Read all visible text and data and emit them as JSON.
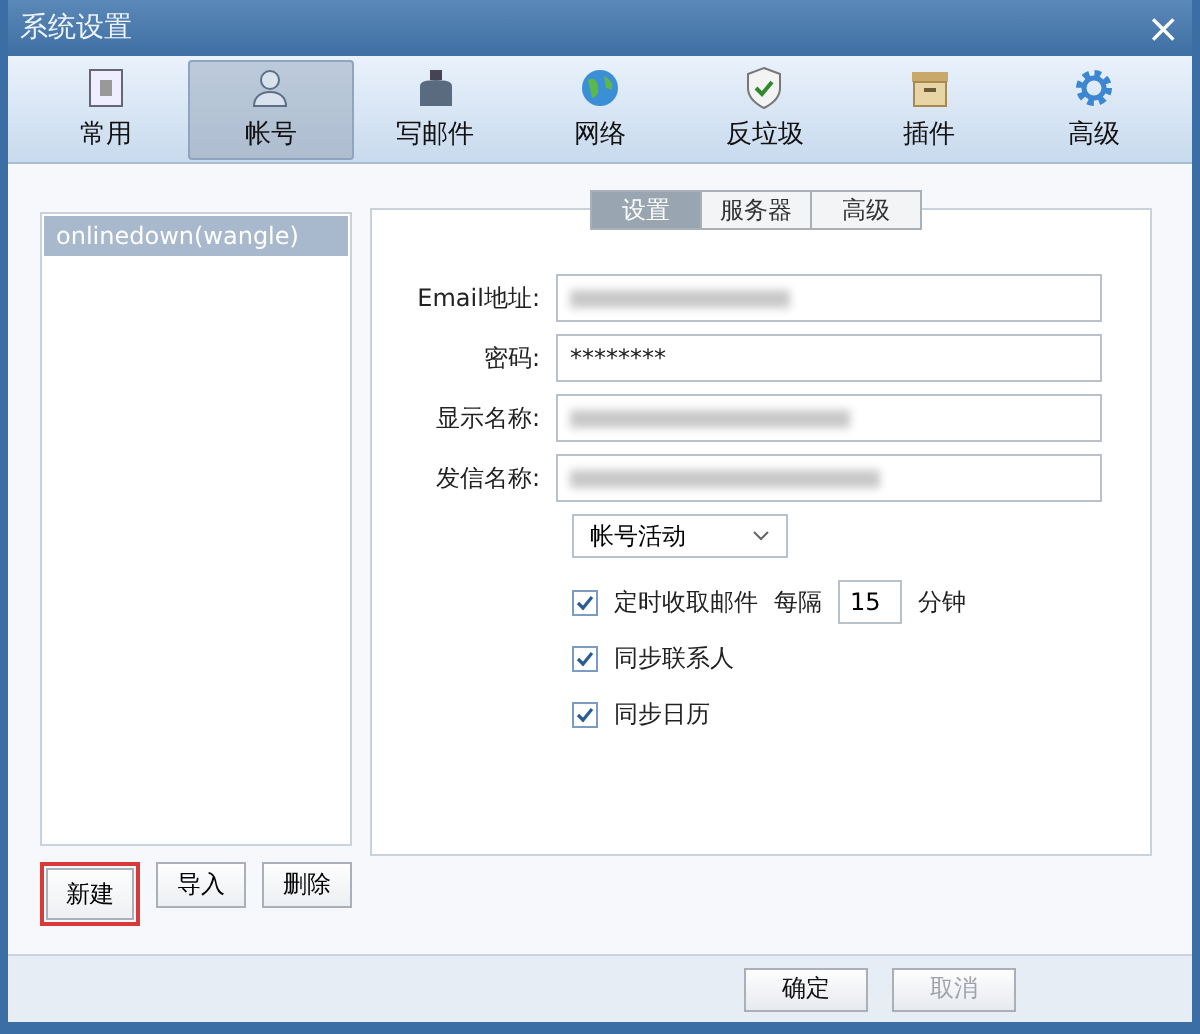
{
  "window": {
    "title": "系统设置",
    "close": "×"
  },
  "toolbar": [
    {
      "label": "常用",
      "kind": "general",
      "selected": false
    },
    {
      "label": "帐号",
      "kind": "account",
      "selected": true
    },
    {
      "label": "写邮件",
      "kind": "compose",
      "selected": false
    },
    {
      "label": "网络",
      "kind": "network",
      "selected": false
    },
    {
      "label": "反垃圾",
      "kind": "antispam",
      "selected": false
    },
    {
      "label": "插件",
      "kind": "plugin",
      "selected": false
    },
    {
      "label": "高级",
      "kind": "advanced",
      "selected": false
    }
  ],
  "accounts": {
    "items": [
      {
        "label": "onlinedown(wangle)",
        "selected": true
      }
    ],
    "buttons": [
      {
        "label": "新建",
        "highlighted": true
      },
      {
        "label": "导入",
        "highlighted": false
      },
      {
        "label": "删除",
        "highlighted": false
      }
    ]
  },
  "settings": {
    "tabs": [
      {
        "label": "设置",
        "selected": true
      },
      {
        "label": "服务器",
        "selected": false
      },
      {
        "label": "高级",
        "selected": false
      }
    ],
    "fields": [
      {
        "label": "Email地址:"
      },
      {
        "label": "密码:",
        "value": "********"
      },
      {
        "label": "显示名称:"
      },
      {
        "label": "发信名称:"
      }
    ],
    "activity_select": "帐号活动",
    "options": [
      {
        "label": "定时收取邮件",
        "checked": true,
        "interval_label": "每隔",
        "interval": "15",
        "unit": "分钟"
      },
      {
        "label": "同步联系人",
        "checked": true
      },
      {
        "label": "同步日历",
        "checked": true
      }
    ]
  },
  "footer": [
    {
      "label": "确定",
      "disabled": false
    },
    {
      "label": "取消",
      "disabled": true
    }
  ]
}
